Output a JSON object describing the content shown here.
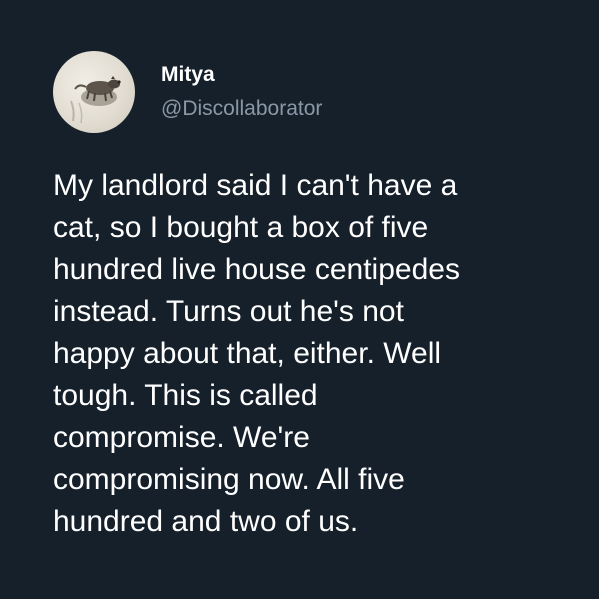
{
  "tweet": {
    "display_name": "Mitya",
    "handle": "@Discollaborator",
    "avatar_icon": "hedgehog-photo-avatar",
    "text": "My landlord said I can't have a\ncat, so I bought a box of five\nhundred live house centipedes\ninstead. Turns out he's not\nhappy about that, either. Well\ntough. This is called\ncompromise. We're\ncompromising now. All five\nhundred and two of us."
  },
  "colors": {
    "background": "#16202b",
    "name": "#ffffff",
    "handle": "#8a98a6",
    "text": "#ffffff"
  }
}
